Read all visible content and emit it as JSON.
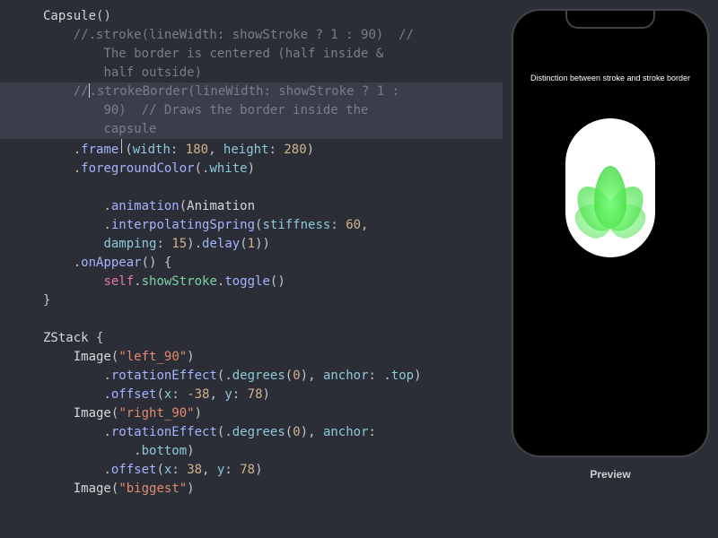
{
  "code": {
    "l1_type": "Capsule",
    "l1_paren": "()",
    "l2_c": "//.stroke(lineWidth: showStroke ? 1 : 90)  //",
    "l3_c": "The border is centered (half inside &",
    "l4_c": "half outside)",
    "l5_c_a": "//",
    "l5_c_b": ".strokeBorder(lineWidth: showStroke ? 1 :",
    "l6_c": "90)  // Draws the border inside the",
    "l7_c": "capsule",
    "l8_m": "frame",
    "l8_p1": "width",
    "l8_n1": "180",
    "l8_p2": "height",
    "l8_n2": "280",
    "l9_m": "foregroundColor",
    "l9_arg": "white",
    "l11_m": "animation",
    "l11_type": "Animation",
    "l12_m": "interpolatingSpring",
    "l12_p1": "stiffness",
    "l12_n1": "60",
    "l13_p": "damping",
    "l13_n": "15",
    "l13_m2": "delay",
    "l13_n2": "1",
    "l14_m": "onAppear",
    "l15_kw": "self",
    "l15_prop": "showStroke",
    "l15_m": "toggle",
    "l16": "}",
    "l18_type": "ZStack",
    "l19_type": "Image",
    "l19_s": "\"left_90\"",
    "l20_m": "rotationEffect",
    "l20_m2": "degrees",
    "l20_n": "0",
    "l20_p": "anchor",
    "l20_v": "top",
    "l21_m": "offset",
    "l21_p1": "x",
    "l21_n1": "-38",
    "l21_p2": "y",
    "l21_n2": "78",
    "l22_type": "Image",
    "l22_s": "\"right_90\"",
    "l23_m": "rotationEffect",
    "l23_m2": "degrees",
    "l23_n": "0",
    "l23_p": "anchor",
    "l24_v": "bottom",
    "l25_m": "offset",
    "l25_p1": "x",
    "l25_n1": "38",
    "l25_p2": "y",
    "l25_n2": "78",
    "l26_type": "Image",
    "l26_s": "\"biggest\""
  },
  "preview": {
    "title": "Distinction between stroke and stroke border",
    "label": "Preview"
  }
}
